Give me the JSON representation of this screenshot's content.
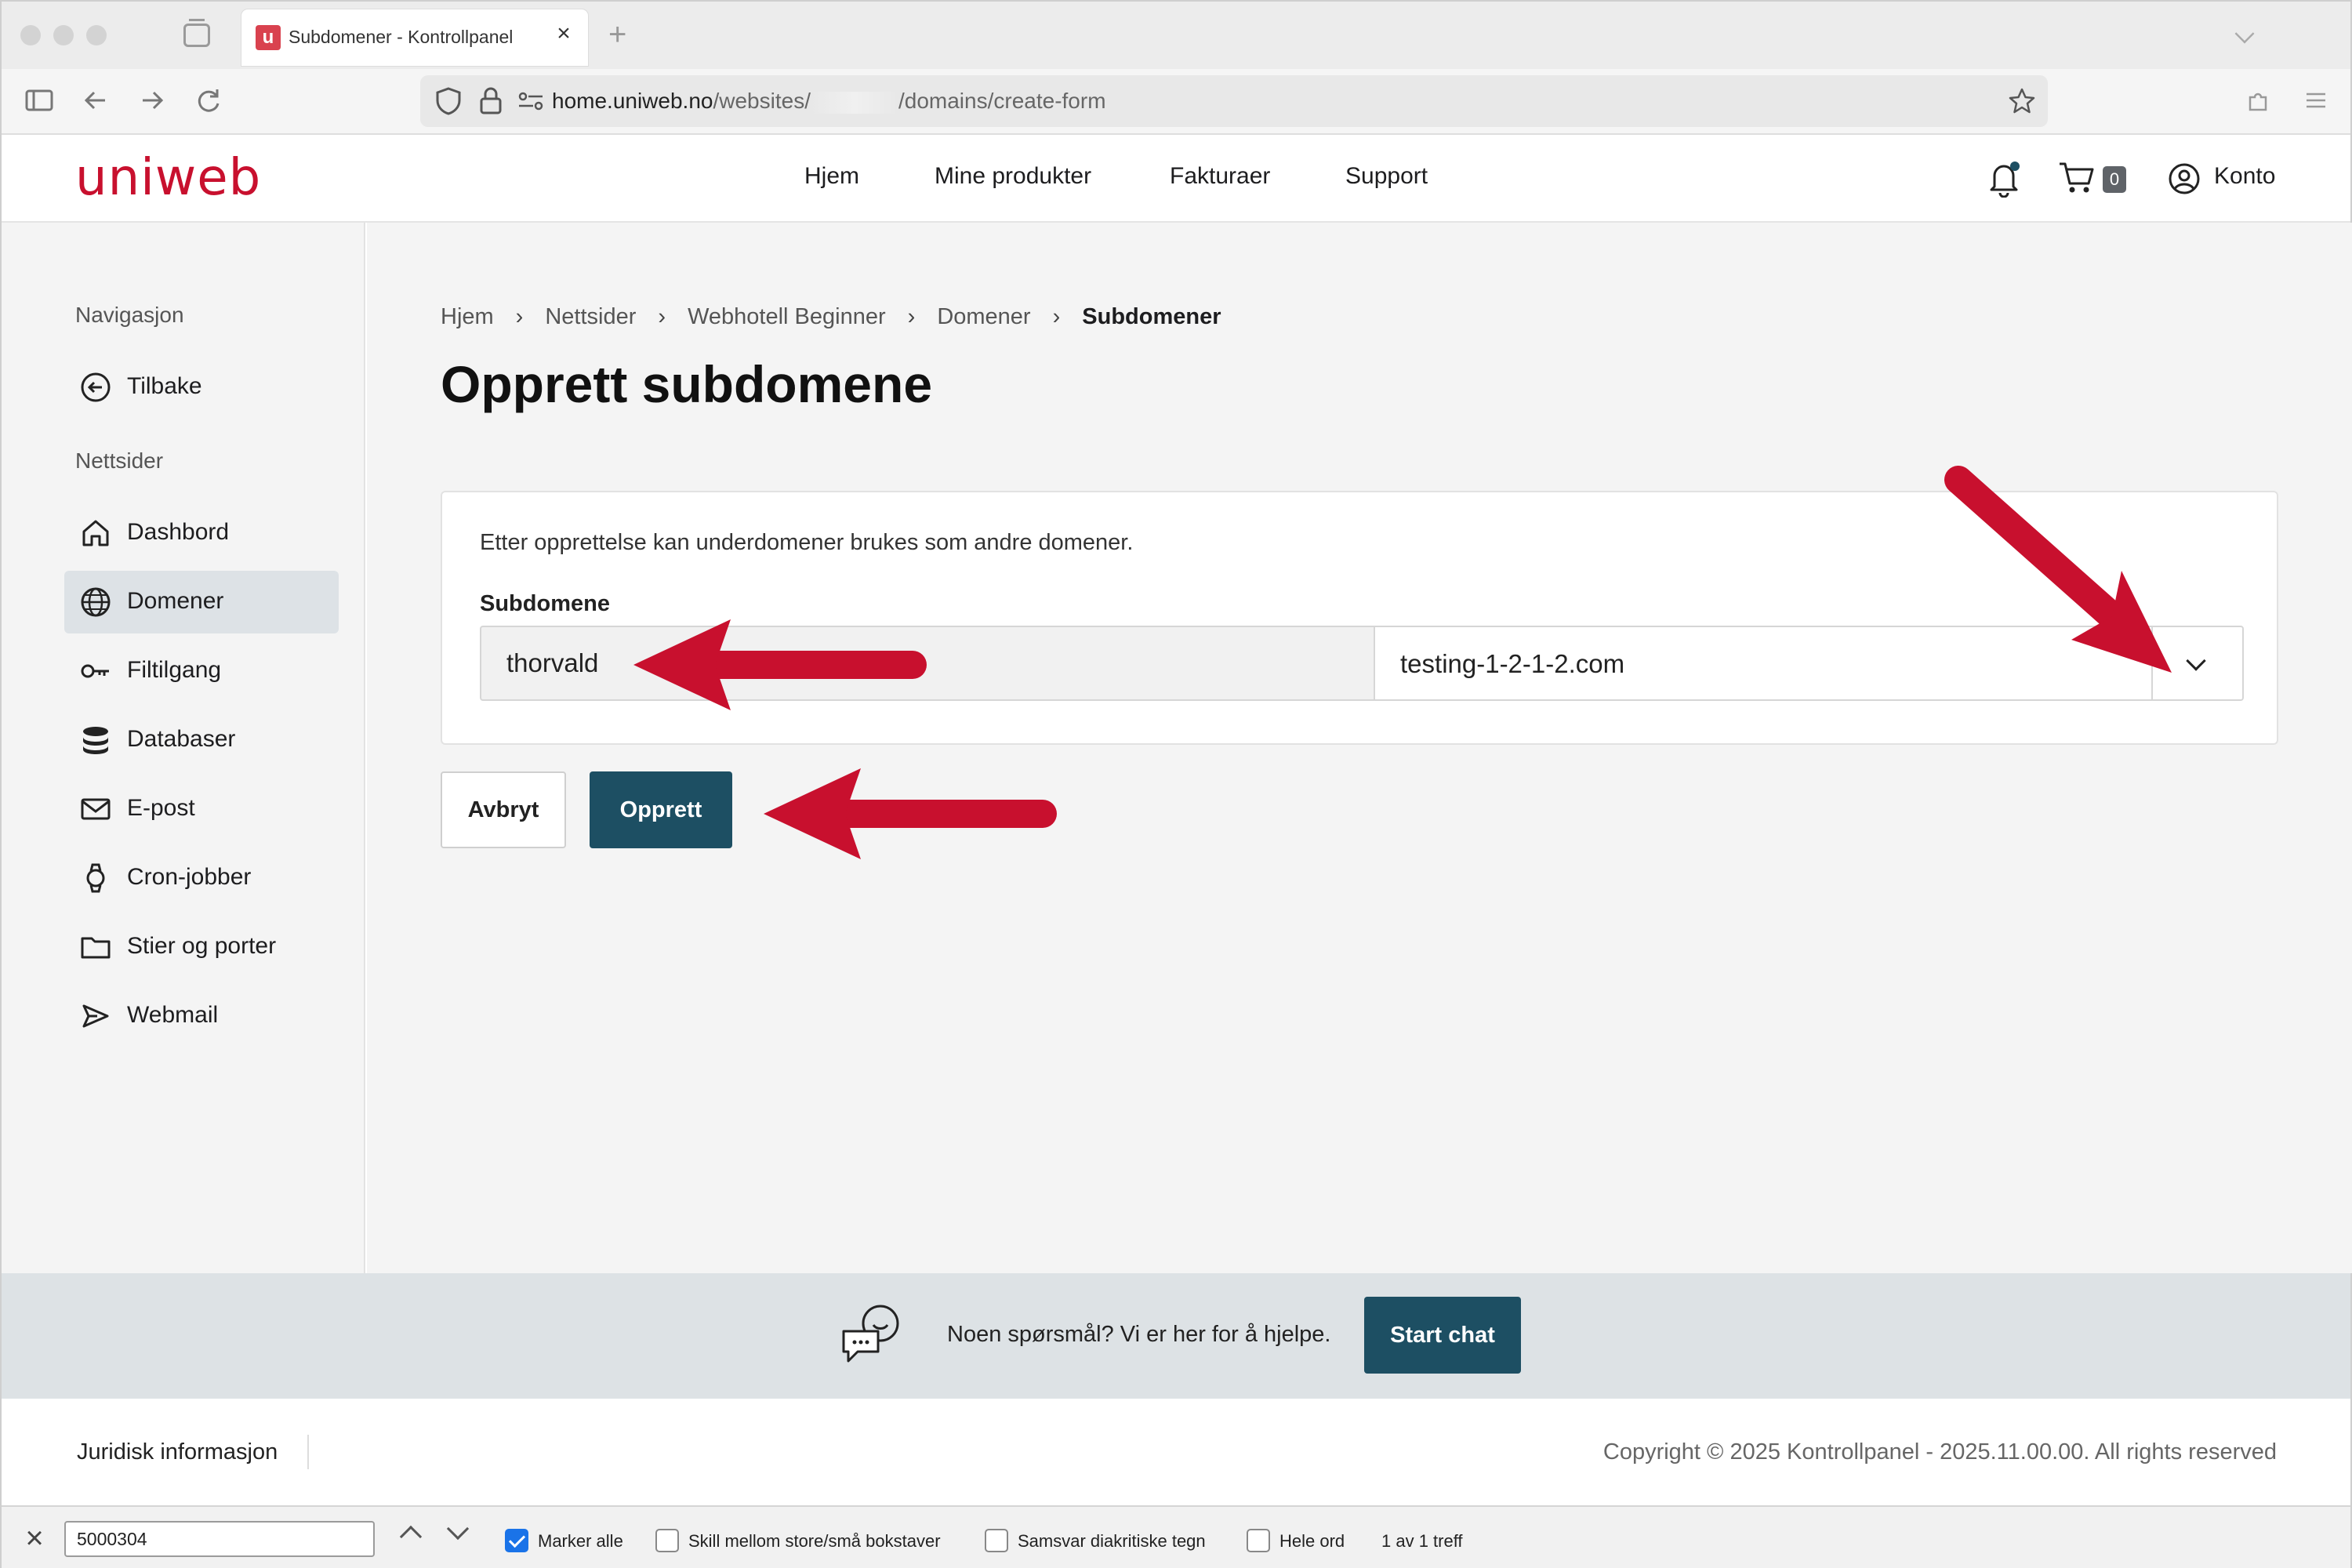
{
  "browser": {
    "tab_title": "Subdomener - Kontrollpanel",
    "tab_favicon_letter": "u",
    "url_host": "home.uniweb.no",
    "url_prefix": "/websites/",
    "url_suffix": "/domains/create-form"
  },
  "site": {
    "logo": "uniweb",
    "nav": [
      "Hjem",
      "Mine produkter",
      "Fakturaer",
      "Support"
    ],
    "cart_count": "0",
    "account_label": "Konto",
    "accent_color": "#c8102e",
    "primary_color": "#1d4f63"
  },
  "sidebar": {
    "heading_nav": "Navigasjon",
    "back_label": "Tilbake",
    "heading_sites": "Nettsider",
    "items": [
      {
        "label": "Dashbord",
        "icon": "home-icon"
      },
      {
        "label": "Domener",
        "icon": "globe-icon",
        "active": true
      },
      {
        "label": "Filtilgang",
        "icon": "key-icon"
      },
      {
        "label": "Databaser",
        "icon": "database-icon"
      },
      {
        "label": "E-post",
        "icon": "mail-icon"
      },
      {
        "label": "Cron-jobber",
        "icon": "watch-icon"
      },
      {
        "label": "Stier og porter",
        "icon": "folder-icon"
      },
      {
        "label": "Webmail",
        "icon": "send-icon"
      }
    ]
  },
  "breadcrumb": [
    "Hjem",
    "Nettsider",
    "Webhotell Beginner",
    "Domener",
    "Subdomener"
  ],
  "page": {
    "title": "Opprett subdomene",
    "description": "Etter opprettelse kan underdomener brukes som andre domener.",
    "field_label": "Subdomene",
    "subdomain_value": "thorvald",
    "domain_selected": "testing-1-2-1-2.com",
    "cancel_label": "Avbryt",
    "create_label": "Opprett"
  },
  "help": {
    "text": "Noen spørsmål? Vi er her for å hjelpe.",
    "button": "Start chat"
  },
  "footer": {
    "legal": "Juridisk informasjon",
    "copyright": "Copyright © 2025 Kontrollpanel - 2025.11.00.00. All rights reserved"
  },
  "findbar": {
    "query": "5000304",
    "options": [
      {
        "label": "Marker alle",
        "checked": true
      },
      {
        "label": "Skill mellom store/små bokstaver",
        "checked": false
      },
      {
        "label": "Samsvar diakritiske tegn",
        "checked": false
      },
      {
        "label": "Hele ord",
        "checked": false
      }
    ],
    "match_count": "1 av 1 treff"
  }
}
